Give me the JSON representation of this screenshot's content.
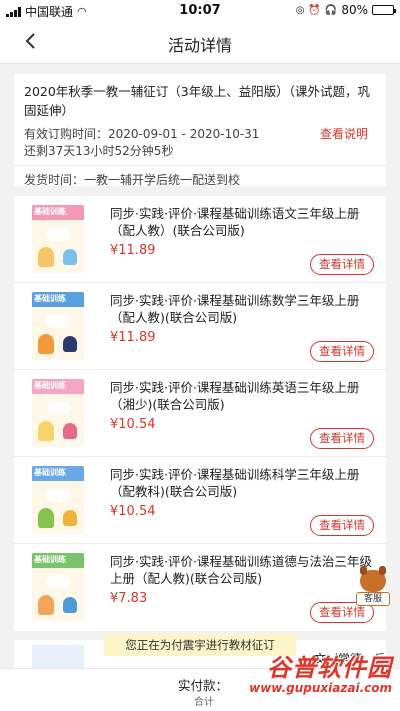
{
  "status_bar": {
    "carrier": "中国联通",
    "time": "10:07",
    "battery_text": "80%",
    "battery_level": 0.8
  },
  "nav": {
    "title": "活动详情"
  },
  "info": {
    "title": "2020年秋季一教一辅征订（3年级上、益阳版）（课外试题，巩固延伸）",
    "order_time": "有效订购时间：2020-09-01 - 2020-10-31",
    "remaining": "还剩37天13小时52分钟5秒",
    "link_label": "查看说明",
    "ship_time": "发货时间：一教一辅开学后统一配送到校"
  },
  "items": [
    {
      "name": "同步·实践·评价·课程基础训练语文三年级上册（配人教）(联合公司版)",
      "price": "¥11.89",
      "button": "查看详情",
      "cover_color": "#f29ab5",
      "cover_band": "基础训练"
    },
    {
      "name": "同步·实践·评价·课程基础训练数学三年级上册（配人教)(联合公司版)",
      "price": "¥11.89",
      "button": "查看详情",
      "cover_color": "#5aa0e0",
      "cover_band": "基础训练"
    },
    {
      "name": "同步·实践·评价·课程基础训练英语三年级上册（湘少)(联合公司版)",
      "price": "¥10.54",
      "button": "查看详情",
      "cover_color": "#f4a7c0",
      "cover_band": "基础训练"
    },
    {
      "name": "同步·实践·评价·课程基础训练科学三年级上册（配教科)(联合公司版)",
      "price": "¥10.54",
      "button": "查看详情",
      "cover_color": "#6aa8e6",
      "cover_band": "基础训练"
    },
    {
      "name": "同步·实践·评价·课程基础训练道德与法治三年级上册（配人教)(联合公司版)",
      "price": "¥7.83",
      "button": "查看详情",
      "cover_color": "#79c36a",
      "cover_band": "基础训练"
    }
  ],
  "partial_item": {
    "name_visible": "文（常德、岳"
  },
  "customer_service": {
    "label": "客服"
  },
  "notice": {
    "text": "您正在为付震宇进行教材征订"
  },
  "bottom_bar": {
    "pay_label": "实付款：",
    "total_label": "合计"
  },
  "watermark": {
    "title": "谷普软件园",
    "url": "www.gupuxiazai.com"
  }
}
